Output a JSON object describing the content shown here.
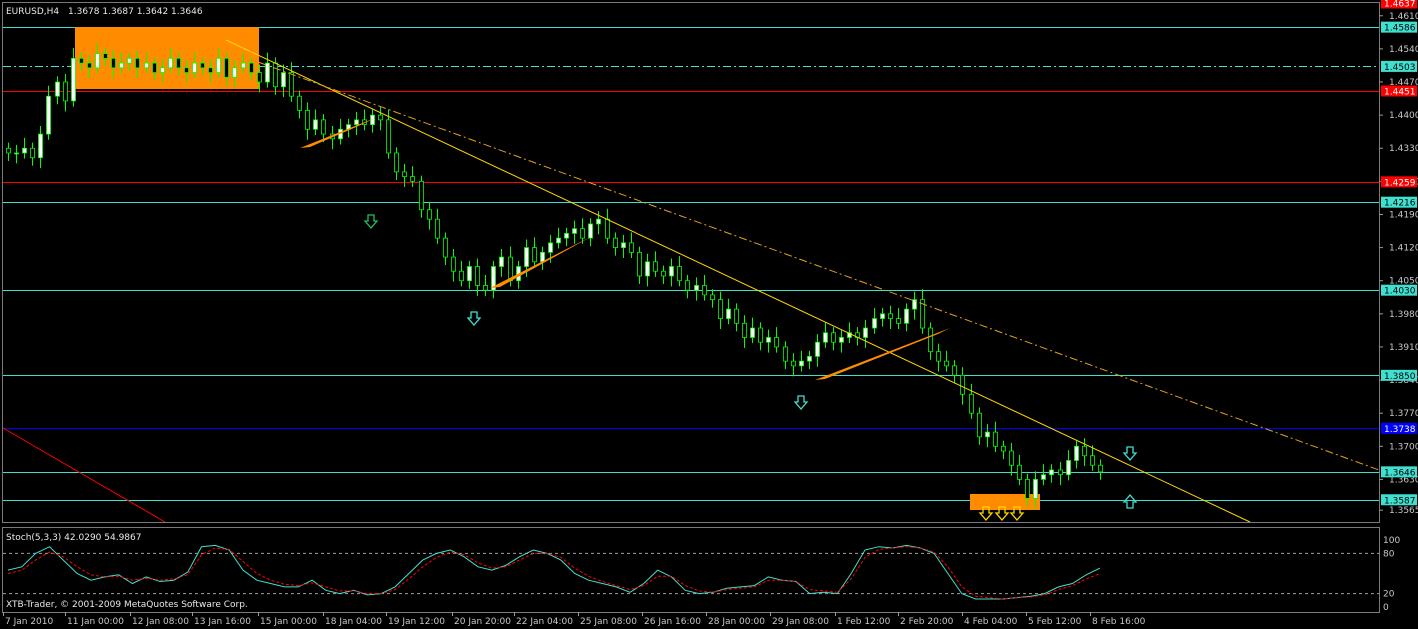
{
  "header": {
    "symbol": "EURUSD,H4",
    "ohlc": "1.3678 1.3687 1.3642 1.3646"
  },
  "oscillator": {
    "label": "Stoch(5,3,3) 42.0290 54.9867",
    "levels": [
      "100",
      "80",
      "20",
      "0"
    ]
  },
  "copyright": "XTB-Trader, © 2001-2009 MetaQuotes Software Corp.",
  "colors": {
    "background": "#000000",
    "bull_candle": "#ffffff",
    "bear_candle": "#000000",
    "wick": "#00ff00",
    "cyan_level": "#40e0d0",
    "red_level": "#ff0000",
    "blue_level": "#0000ff",
    "trendline": "#ffd700",
    "zone": "#ff8c00",
    "stoch_main": "#40e0d0",
    "stoch_signal": "#ff0000"
  },
  "chart_data": {
    "type": "candlestick",
    "symbol": "EURUSD",
    "timeframe": "H4",
    "ylim": [
      1.3565,
      1.461
    ],
    "price_ticks": [
      "1.4610",
      "1.4540",
      "1.4470",
      "1.4400",
      "1.4330",
      "1.4260",
      "1.4190",
      "1.4120",
      "1.4050",
      "1.3980",
      "1.3910",
      "1.3840",
      "1.3770",
      "1.3700",
      "1.3630",
      "1.3565"
    ],
    "time_ticks": [
      "7 Jan 2010",
      "11 Jan 00:00",
      "12 Jan 08:00",
      "13 Jan 16:00",
      "15 Jan 00:00",
      "18 Jan 04:00",
      "19 Jan 12:00",
      "20 Jan 20:00",
      "22 Jan 04:00",
      "25 Jan 08:00",
      "26 Jan 16:00",
      "28 Jan 00:00",
      "29 Jan 08:00",
      "1 Feb 12:00",
      "2 Feb 20:00",
      "4 Feb 04:00",
      "5 Feb 12:00",
      "8 Feb 16:00"
    ],
    "levels": [
      {
        "price": 1.4586,
        "label": "1.4586",
        "color": "#40e0d0",
        "style": "solid"
      },
      {
        "price": 1.4503,
        "label": "1.4503",
        "color": "#40e0d0",
        "style": "dashdot"
      },
      {
        "price": 1.4451,
        "label": "1.4451",
        "color": "#ff0000",
        "style": "solid"
      },
      {
        "price": 1.4259,
        "label": "1.4259",
        "color": "#ff0000",
        "style": "solid"
      },
      {
        "price": 1.4216,
        "label": "1.4216",
        "color": "#40e0d0",
        "style": "solid"
      },
      {
        "price": 1.403,
        "label": "1.4030",
        "color": "#40e0d0",
        "style": "solid"
      },
      {
        "price": 1.385,
        "label": "1.3850",
        "color": "#40e0d0",
        "style": "solid"
      },
      {
        "price": 1.3738,
        "label": "1.3738",
        "color": "#0000ff",
        "style": "solid"
      },
      {
        "price": 1.3646,
        "label": "1.3646",
        "color": "#40e0d0",
        "style": "solid"
      },
      {
        "price": 1.3587,
        "label": "1.3587",
        "color": "#40e0d0",
        "style": "solid"
      }
    ],
    "top_badge": {
      "price": 1.4637,
      "label": "1.4637",
      "color": "#ff0000"
    },
    "closes": [
      1.432,
      1.432,
      1.433,
      1.431,
      1.436,
      1.444,
      1.447,
      1.443,
      1.452,
      1.451,
      1.45,
      1.453,
      1.452,
      1.45,
      1.451,
      1.452,
      1.45,
      1.451,
      1.449,
      1.45,
      1.452,
      1.45,
      1.449,
      1.451,
      1.45,
      1.449,
      1.452,
      1.448,
      1.45,
      1.451,
      1.449,
      1.447,
      1.451,
      1.446,
      1.449,
      1.444,
      1.441,
      1.437,
      1.439,
      1.436,
      1.435,
      1.437,
      1.438,
      1.439,
      1.438,
      1.44,
      1.439,
      1.432,
      1.428,
      1.427,
      1.426,
      1.42,
      1.418,
      1.414,
      1.41,
      1.407,
      1.405,
      1.408,
      1.404,
      1.403,
      1.408,
      1.41,
      1.405,
      1.408,
      1.412,
      1.409,
      1.411,
      1.413,
      1.414,
      1.415,
      1.416,
      1.414,
      1.417,
      1.418,
      1.414,
      1.412,
      1.413,
      1.411,
      1.406,
      1.409,
      1.407,
      1.406,
      1.408,
      1.405,
      1.403,
      1.404,
      1.402,
      1.401,
      1.397,
      1.399,
      1.396,
      1.393,
      1.395,
      1.392,
      1.393,
      1.391,
      1.388,
      1.387,
      1.388,
      1.389,
      1.392,
      1.394,
      1.392,
      1.393,
      1.394,
      1.393,
      1.395,
      1.397,
      1.398,
      1.397,
      1.396,
      1.399,
      1.401,
      1.395,
      1.39,
      1.388,
      1.387,
      1.385,
      1.381,
      1.377,
      1.372,
      1.373,
      1.37,
      1.369,
      1.366,
      1.363,
      1.359,
      1.363,
      1.364,
      1.365,
      1.364,
      1.367,
      1.37,
      1.368,
      1.366,
      1.3646
    ],
    "stoch_k": [
      55,
      60,
      80,
      90,
      70,
      50,
      40,
      45,
      48,
      35,
      45,
      38,
      40,
      52,
      90,
      92,
      85,
      55,
      40,
      35,
      30,
      30,
      40,
      25,
      20,
      25,
      18,
      20,
      30,
      50,
      70,
      80,
      85,
      75,
      60,
      55,
      62,
      75,
      85,
      80,
      70,
      50,
      40,
      35,
      30,
      22,
      35,
      55,
      45,
      25,
      20,
      22,
      28,
      30,
      32,
      45,
      40,
      38,
      20,
      22,
      20,
      50,
      85,
      90,
      88,
      92,
      88,
      80,
      50,
      20,
      12,
      12,
      12,
      14,
      16,
      20,
      30,
      35,
      48,
      58
    ],
    "stoch_d": [
      50,
      55,
      70,
      82,
      75,
      60,
      48,
      45,
      46,
      40,
      43,
      40,
      42,
      48,
      78,
      88,
      86,
      68,
      50,
      40,
      34,
      32,
      36,
      30,
      24,
      24,
      20,
      20,
      26,
      42,
      60,
      74,
      82,
      78,
      66,
      58,
      60,
      70,
      80,
      80,
      74,
      58,
      46,
      38,
      32,
      26,
      32,
      46,
      46,
      32,
      24,
      22,
      26,
      28,
      30,
      40,
      40,
      38,
      26,
      24,
      22,
      42,
      74,
      86,
      88,
      90,
      88,
      82,
      60,
      30,
      16,
      14,
      12,
      14,
      15,
      18,
      26,
      32,
      42,
      50
    ]
  }
}
